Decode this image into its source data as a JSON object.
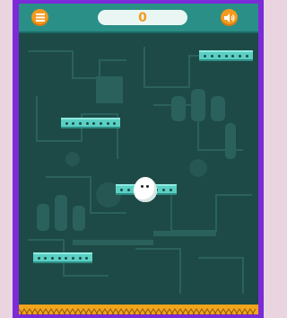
{
  "hud": {
    "score": "0",
    "menu_icon": "hamburger-menu-icon",
    "sound_icon": "speaker-icon"
  },
  "player": {
    "character": "white-egg"
  },
  "colors": {
    "frame": "#7b2bd8",
    "background": "#1d4a46",
    "topbar": "#2a8f86",
    "accent": "#f39a1e",
    "platform": "#5ad0c4",
    "hazard": "#f2a41c"
  }
}
